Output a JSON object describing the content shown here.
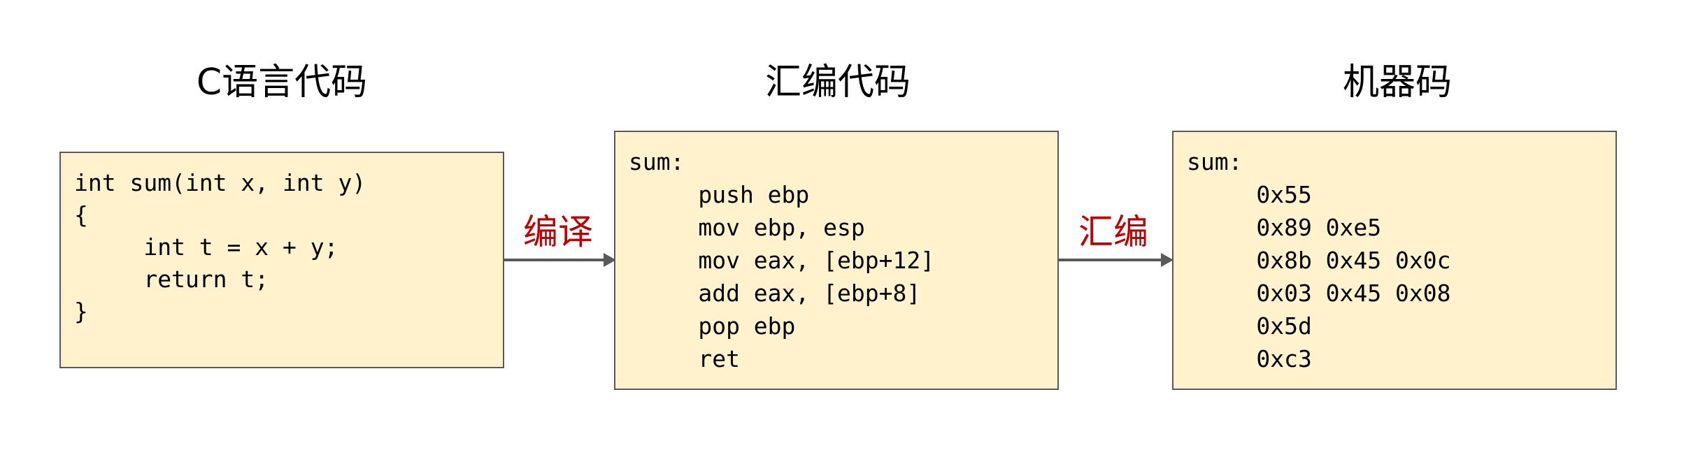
{
  "titles": {
    "c_code": "C语言代码",
    "asm_code": "汇编代码",
    "machine_code": "机器码"
  },
  "arrows": {
    "compile": "编译",
    "assemble": "汇编"
  },
  "c_box": {
    "lines": [
      "int sum(int x, int y)",
      "{",
      "     int t = x + y;",
      "     return t;",
      "}"
    ]
  },
  "asm_box": {
    "lines": [
      "sum:",
      "     push ebp",
      "     mov ebp, esp",
      "     mov eax, [ebp+12]",
      "     add eax, [ebp+8]",
      "     pop ebp",
      "     ret"
    ]
  },
  "machine_box": {
    "lines": [
      "sum:",
      "     0x55",
      "     0x89 0xe5",
      "     0x8b 0x45 0x0c",
      "     0x03 0x45 0x08",
      "     0x5d",
      "     0xc3"
    ]
  },
  "colors": {
    "box_fill": "#fff2cc",
    "box_border": "#595959",
    "arrow": "#595959",
    "arrow_label": "#c00000"
  }
}
